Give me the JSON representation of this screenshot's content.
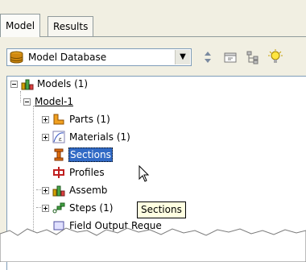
{
  "tabs": [
    {
      "label": "Model",
      "active": true
    },
    {
      "label": "Results",
      "active": false
    }
  ],
  "toolbar": {
    "combo_value": "Model Database",
    "icons": [
      "expand-collapse-icon",
      "filter-tree-icon",
      "hierarchy-icon",
      "lightbulb-icon"
    ]
  },
  "tree": {
    "models": "Models (1)",
    "model1": "Model-1",
    "parts": "Parts (1)",
    "materials": "Materials (1)",
    "sections": "Sections",
    "profiles": "Profiles",
    "assembly": "Assemb",
    "steps": "Steps (1)",
    "partial": "Field Output Reque"
  },
  "tooltip": "Sections",
  "colors": {
    "selection": "#316ac5",
    "tooltip_bg": "#ffffe1",
    "panel_bg": "#f1efe2"
  }
}
